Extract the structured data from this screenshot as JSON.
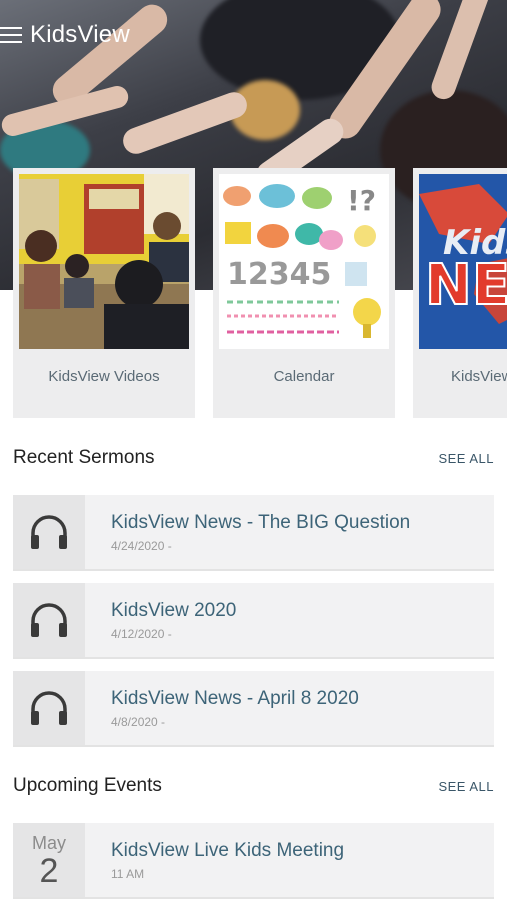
{
  "app": {
    "title": "KidsView"
  },
  "cards": [
    {
      "label": "KidsView Videos"
    },
    {
      "label": "Calendar"
    },
    {
      "label": "KidsView"
    }
  ],
  "recent_sermons": {
    "heading": "Recent Sermons",
    "see_all": "SEE ALL",
    "items": [
      {
        "title": "KidsView News - The BIG Question",
        "date": "4/24/2020 -"
      },
      {
        "title": "KidsView 2020",
        "date": "4/12/2020 -"
      },
      {
        "title": "KidsView News - April 8 2020",
        "date": "4/8/2020 -"
      }
    ]
  },
  "upcoming_events": {
    "heading": "Upcoming Events",
    "see_all": "SEE ALL",
    "items": [
      {
        "month": "May",
        "day": "2",
        "title": "KidsView Live Kids Meeting",
        "time": "11 AM"
      }
    ]
  },
  "thumb_text": {
    "calendar_digits": "12345",
    "calendar_marks": "!?",
    "news_title_1": "Kids",
    "news_title_2": "NE"
  },
  "colors": {
    "accent": "#3d6478",
    "see_all": "#3a5668",
    "card_bg": "#ededee"
  }
}
